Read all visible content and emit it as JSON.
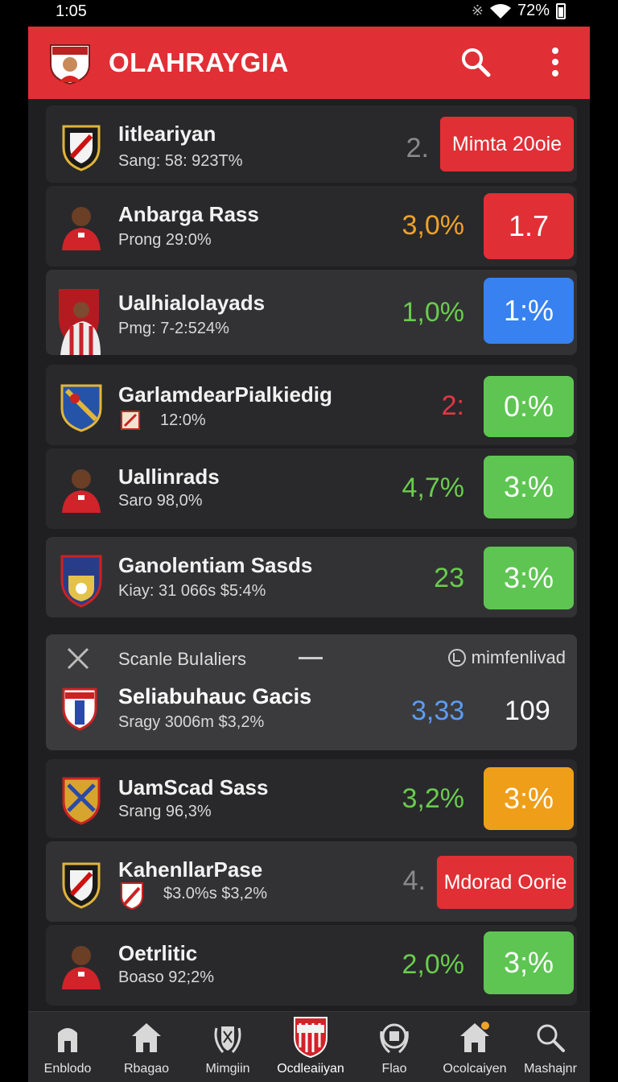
{
  "status_bar": {
    "time": "1:05",
    "battery": "72%"
  },
  "header": {
    "title": "OLAHRAYGIA",
    "search_icon": "search-icon",
    "menu_icon": "more-vertical-icon"
  },
  "rows": [
    {
      "name": "Iitleariyan",
      "sub": "Sang: 58: 923T%",
      "stat": "2.",
      "stat_color": "grey",
      "badge": "Mimta 20oie",
      "badge_color": "#e12f36"
    },
    {
      "name": "Anbarga Rass",
      "sub": "Prong 29:0%",
      "stat": "3,0%",
      "stat_color": "orange",
      "badge": "1.7",
      "badge_color": "#e12f36"
    },
    {
      "name": "Ualhialolayads",
      "sub": "Pmg: 7-2:524%",
      "stat": "1,0%",
      "stat_color": "green",
      "badge": "1:%",
      "badge_color": "#3781f0"
    },
    {
      "name": "GarlamdearPialkiedig",
      "sub": "12:0%",
      "stat": "2:",
      "stat_color": "red",
      "badge": "0:%",
      "badge_color": "#5ec552"
    },
    {
      "name": "Uallinrads",
      "sub": "Saro 98,0%",
      "stat": "4,7%",
      "stat_color": "green",
      "badge": "3:%",
      "badge_color": "#5ec552"
    },
    {
      "name": "Ganolentiam Sasds",
      "sub": "Kiay: 31 066s $5:4%",
      "stat": "23",
      "stat_color": "green",
      "badge": "3:%",
      "badge_color": "#5ec552"
    }
  ],
  "expanded": {
    "label": "Scanle BuIaliers",
    "verified_label": "mimfenlivad",
    "name": "Seliabuhauc Gacis",
    "sub": "Sragy 3006m $3,2%",
    "stat": "3,33",
    "value": "109"
  },
  "rows_after": [
    {
      "name": "UamScad Sass",
      "sub": "Srang 96,3%",
      "stat": "3,2%",
      "stat_color": "green",
      "badge": "3:%",
      "badge_color": "#ef9e1a"
    },
    {
      "name": "KahenllarPase",
      "sub": "$3.0%s $3,2%",
      "stat": "4.",
      "stat_color": "grey",
      "badge": "Mdorad Oorie",
      "badge_color": "#e12f36"
    },
    {
      "name": "Oetrlitic",
      "sub": "Boaso 92;2%",
      "stat": "2,0%",
      "stat_color": "green",
      "badge": "3;%",
      "badge_color": "#5ec552"
    }
  ],
  "nav": [
    {
      "label": "Enblodo",
      "icon": "building-icon"
    },
    {
      "label": "Rbagao",
      "icon": "home-icon"
    },
    {
      "label": "Mimgiin",
      "icon": "laurel-crest-icon"
    },
    {
      "label": "Ocdleaiiyan",
      "icon": "club-crest-icon"
    },
    {
      "label": "Flao",
      "icon": "laurel-badge-icon"
    },
    {
      "label": "Ocolcaiyen",
      "icon": "home-notification-icon"
    },
    {
      "label": "Mashajnr",
      "icon": "search-icon"
    }
  ]
}
